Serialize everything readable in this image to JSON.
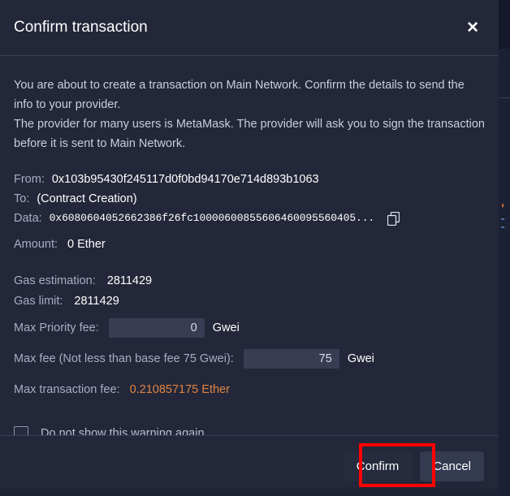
{
  "modal": {
    "title": "Confirm transaction",
    "close_icon": "close-icon",
    "intro": {
      "paragraph_1": "You are about to create a transaction on Main Network. Confirm the details to send the info to your provider.",
      "paragraph_2": "The provider for many users is MetaMask. The provider will ask you to sign the transaction before it is sent to Main Network."
    },
    "details": {
      "from_label": "From:",
      "from_value": "0x103b95430f245117d0f0bd94170e714d893b1063",
      "to_label": "To:",
      "to_value": "(Contract Creation)",
      "data_label": "Data:",
      "data_value": "0x6080604052662386f26fc10000600855606460095560405...",
      "copy_icon": "copy-icon",
      "amount_label": "Amount:",
      "amount_value": "0 Ether"
    },
    "gas": {
      "estimation_label": "Gas estimation:",
      "estimation_value": "2811429",
      "limit_label": "Gas limit:",
      "limit_value": "2811429",
      "max_priority_fee_label": "Max Priority fee:",
      "max_priority_fee_value": "0",
      "max_priority_fee_unit": "Gwei",
      "max_fee_label": "Max fee (Not less than base fee 75 Gwei):",
      "max_fee_value": "75",
      "max_fee_unit": "Gwei",
      "max_transaction_fee_label": "Max transaction fee:",
      "max_transaction_fee_value": "0.210857175 Ether"
    },
    "warning": {
      "checkbox_checked": false,
      "label": "Do not show this warning again."
    },
    "footer": {
      "confirm_label": "Confirm",
      "cancel_label": "Cancel"
    }
  },
  "colors": {
    "modal_background": "#232739",
    "accent_fee": "#e08443",
    "highlight": "#ff0000",
    "label_text": "#a7adc4",
    "value_text": "#ffffff"
  }
}
